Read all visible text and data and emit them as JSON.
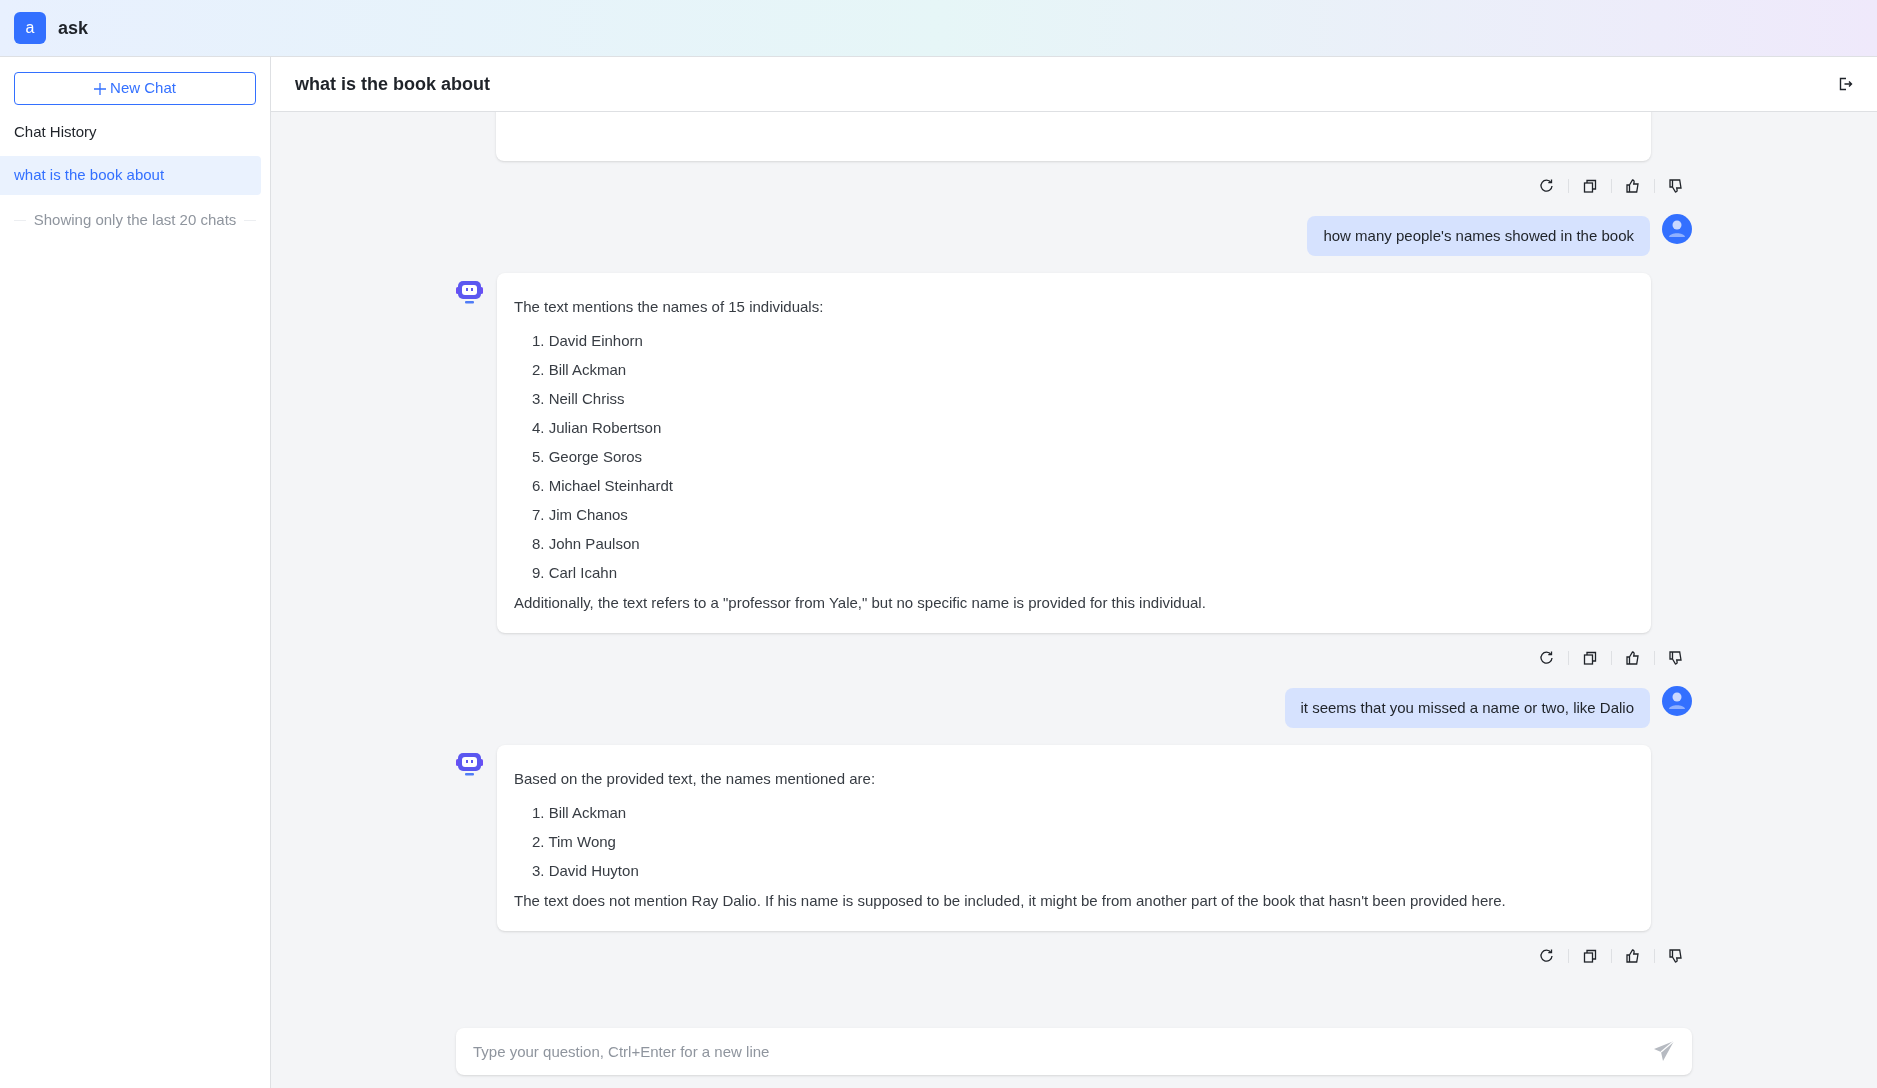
{
  "app": {
    "logo_letter": "a",
    "name": "ask"
  },
  "sidebar": {
    "new_chat": "New Chat",
    "history_title": "Chat History",
    "items": [
      {
        "label": "what is the book about",
        "selected": true
      }
    ],
    "footer_note": "Showing only the last 20 chats"
  },
  "chat": {
    "title": "what is the book about",
    "messages": [
      {
        "kind": "cut"
      },
      {
        "kind": "user",
        "text": "how many people's names showed in the book"
      },
      {
        "kind": "bot",
        "intro": "The text mentions the names of 15 individuals:",
        "items": [
          "1. David Einhorn",
          "2. Bill Ackman",
          "3. Neill Chriss",
          "4. Julian Robertson",
          "5. George Soros",
          "6. Michael Steinhardt",
          "7. Jim Chanos",
          "8. John Paulson",
          "9. Carl Icahn"
        ],
        "outro": "Additionally, the text refers to a \"professor from Yale,\" but no specific name is provided for this individual."
      },
      {
        "kind": "user",
        "text": "it seems that you missed a name or two, like Dalio"
      },
      {
        "kind": "bot",
        "intro": "Based on the provided text, the names mentioned are:",
        "items": [
          "1. Bill Ackman",
          "2. Tim Wong",
          "3. David Huyton"
        ],
        "outro": "The text does not mention Ray Dalio. If his name is supposed to be included, it might be from another part of the book that hasn't been provided here."
      }
    ],
    "input": {
      "placeholder": "Type your question, Ctrl+Enter for a new line"
    }
  }
}
